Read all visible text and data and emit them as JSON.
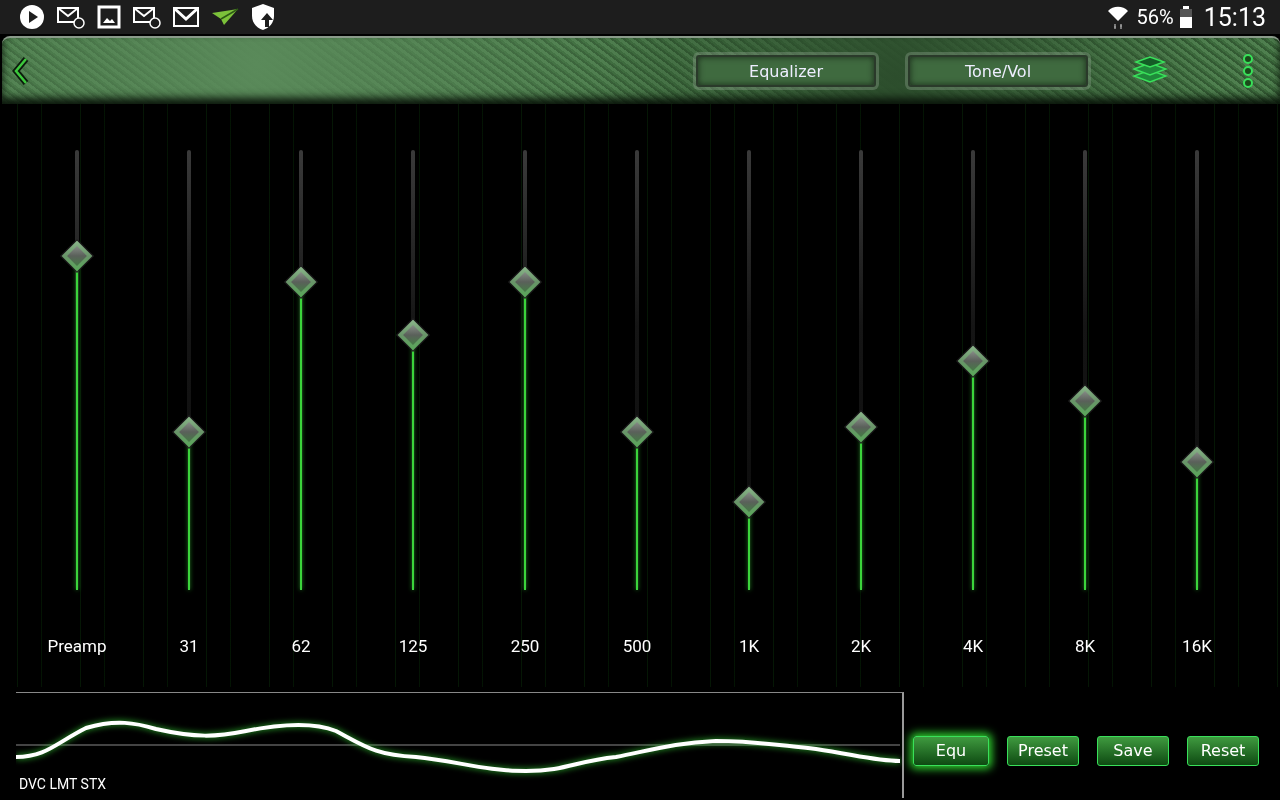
{
  "status_bar": {
    "battery": "56%",
    "time": "15:13"
  },
  "toolbar": {
    "tabs": [
      {
        "label": "Equalizer"
      },
      {
        "label": "Tone/Vol"
      }
    ]
  },
  "bands": [
    {
      "label": "Preamp",
      "level": 0.76
    },
    {
      "label": "31",
      "level": 0.36
    },
    {
      "label": "62",
      "level": 0.7
    },
    {
      "label": "125",
      "level": 0.58
    },
    {
      "label": "250",
      "level": 0.7
    },
    {
      "label": "500",
      "level": 0.36
    },
    {
      "label": "1K",
      "level": 0.2
    },
    {
      "label": "2K",
      "level": 0.37
    },
    {
      "label": "4K",
      "level": 0.52
    },
    {
      "label": "8K",
      "level": 0.43
    },
    {
      "label": "16K",
      "level": 0.29
    }
  ],
  "graph": {
    "label": "DVC LMT STX"
  },
  "buttons": [
    {
      "label": "Equ",
      "on": true
    },
    {
      "label": "Preset",
      "on": false
    },
    {
      "label": "Save",
      "on": false
    },
    {
      "label": "Reset",
      "on": false
    }
  ]
}
